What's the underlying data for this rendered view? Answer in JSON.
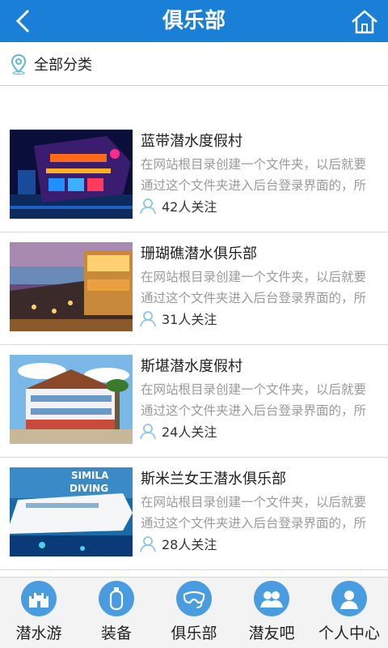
{
  "header": {
    "title": "俱乐部"
  },
  "filter": {
    "label": "全部分类"
  },
  "clubs": [
    {
      "name": "蓝带潜水度假村",
      "desc": "在网站根目录创建一个文件夹，以后就要通过这个文件夹进入后台登录界面的，所",
      "follow": "42人关注"
    },
    {
      "name": "珊瑚礁潜水俱乐部",
      "desc": "在网站根目录创建一个文件夹，以后就要通过这个文件夹进入后台登录界面的，所",
      "follow": "31人关注"
    },
    {
      "name": "斯堪潜水度假村",
      "desc": "在网站根目录创建一个文件夹，以后就要通过这个文件夹进入后台登录界面的，所",
      "follow": "24人关注"
    },
    {
      "name": "斯米兰女王潜水俱乐部",
      "desc": "在网站根目录创建一个文件夹，以后就要通过这个文件夹进入后台登录界面的，所",
      "follow": "28人关注"
    }
  ],
  "thumb_texts": {
    "diving_sign_1": "SIMILA",
    "diving_sign_2": "DIVING"
  },
  "tabs": [
    {
      "label": "潜水游",
      "icon": "castle-icon"
    },
    {
      "label": "装备",
      "icon": "tank-icon"
    },
    {
      "label": "俱乐部",
      "icon": "mask-icon"
    },
    {
      "label": "潜友吧",
      "icon": "group-icon"
    },
    {
      "label": "个人中心",
      "icon": "user-icon"
    }
  ],
  "colors": {
    "header": "#1a7fd6",
    "tab_icon": "#4a9ce0",
    "follow_icon": "#8cc4ec",
    "pin": "#5fb8d8"
  }
}
